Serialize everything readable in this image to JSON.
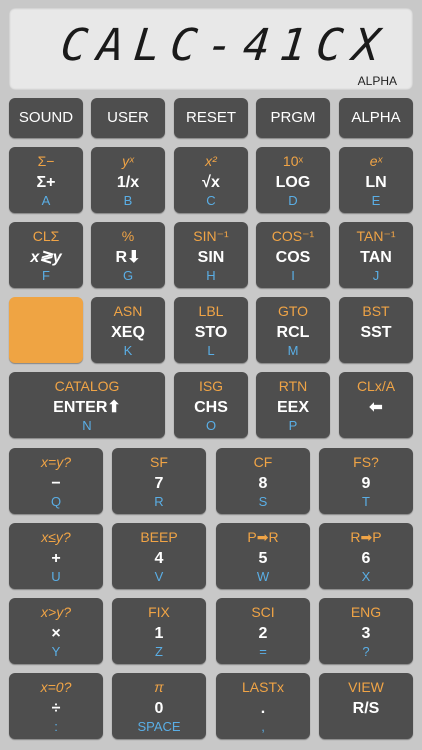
{
  "display": {
    "text": "CALC-41CX",
    "annunciator": "ALPHA"
  },
  "top_row": [
    "SOUND",
    "USER",
    "RESET",
    "PRGM",
    "ALPHA"
  ],
  "rows": [
    [
      {
        "gold": "Σ−",
        "main": "Σ+",
        "blue": "A"
      },
      {
        "gold": "yˣ",
        "main": "1/x",
        "blue": "B"
      },
      {
        "gold": "x²",
        "main": "√x",
        "blue": "C"
      },
      {
        "gold": "10ˣ",
        "main": "LOG",
        "blue": "D"
      },
      {
        "gold": "eˣ",
        "main": "LN",
        "blue": "E"
      }
    ],
    [
      {
        "gold": "CLΣ",
        "main": "x≷y",
        "blue": "F"
      },
      {
        "gold": "%",
        "main": "R⬇",
        "blue": "G"
      },
      {
        "gold": "SIN⁻¹",
        "main": "SIN",
        "blue": "H"
      },
      {
        "gold": "COS⁻¹",
        "main": "COS",
        "blue": "I"
      },
      {
        "gold": "TAN⁻¹",
        "main": "TAN",
        "blue": "J"
      }
    ],
    [
      {
        "gold": "",
        "main": "",
        "blue": ""
      },
      {
        "gold": "ASN",
        "main": "XEQ",
        "blue": "K"
      },
      {
        "gold": "LBL",
        "main": "STO",
        "blue": "L"
      },
      {
        "gold": "GTO",
        "main": "RCL",
        "blue": "M"
      },
      {
        "gold": "BST",
        "main": "SST",
        "blue": ""
      }
    ],
    [
      {
        "gold": "CATALOG",
        "main": "ENTER⬆",
        "blue": "N"
      },
      {
        "gold": "ISG",
        "main": "CHS",
        "blue": "O"
      },
      {
        "gold": "RTN",
        "main": "EEX",
        "blue": "P"
      },
      {
        "gold": "CLx/A",
        "main": "⬅",
        "blue": ""
      }
    ],
    [
      {
        "gold": "x=y?",
        "main": "−",
        "blue": "Q"
      },
      {
        "gold": "SF",
        "main": "7",
        "blue": "R"
      },
      {
        "gold": "CF",
        "main": "8",
        "blue": "S"
      },
      {
        "gold": "FS?",
        "main": "9",
        "blue": "T"
      }
    ],
    [
      {
        "gold": "x≤y?",
        "main": "+",
        "blue": "U"
      },
      {
        "gold": "BEEP",
        "main": "4",
        "blue": "V"
      },
      {
        "gold": "P➡R",
        "main": "5",
        "blue": "W"
      },
      {
        "gold": "R➡P",
        "main": "6",
        "blue": "X"
      }
    ],
    [
      {
        "gold": "x>y?",
        "main": "×",
        "blue": "Y"
      },
      {
        "gold": "FIX",
        "main": "1",
        "blue": "Z"
      },
      {
        "gold": "SCI",
        "main": "2",
        "blue": "="
      },
      {
        "gold": "ENG",
        "main": "3",
        "blue": "?"
      }
    ],
    [
      {
        "gold": "x=0?",
        "main": "÷",
        "blue": ":"
      },
      {
        "gold": "π",
        "main": "0",
        "blue": "SPACE"
      },
      {
        "gold": "LASTx",
        "main": ".",
        "blue": ","
      },
      {
        "gold": "VIEW",
        "main": "R/S",
        "blue": ""
      }
    ]
  ],
  "colors": {
    "shift_key": "#efa443",
    "key": "#4e4e4e",
    "gold": "#f0a446",
    "blue": "#5aaee5"
  }
}
